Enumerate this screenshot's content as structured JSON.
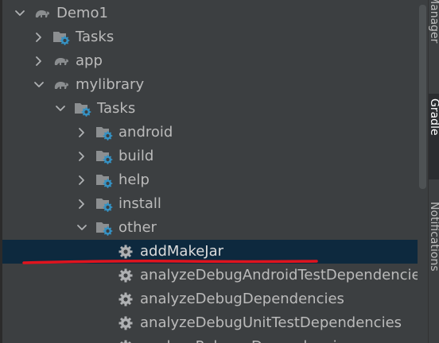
{
  "tree": {
    "rows": [
      {
        "label": "Demo1",
        "icon": "elephant-icon",
        "arrow": "down",
        "level": 0
      },
      {
        "label": "Tasks",
        "icon": "tasks-folder-icon",
        "arrow": "right",
        "level": 1
      },
      {
        "label": "app",
        "icon": "elephant-icon",
        "arrow": "right",
        "level": 1
      },
      {
        "label": "mylibrary",
        "icon": "elephant-icon",
        "arrow": "down",
        "level": 1
      },
      {
        "label": "Tasks",
        "icon": "tasks-folder-icon",
        "arrow": "down",
        "level": 2
      },
      {
        "label": "android",
        "icon": "tasks-folder-icon",
        "arrow": "right",
        "level": 3
      },
      {
        "label": "build",
        "icon": "tasks-folder-icon",
        "arrow": "right",
        "level": 3
      },
      {
        "label": "help",
        "icon": "tasks-folder-icon",
        "arrow": "right",
        "level": 3
      },
      {
        "label": "install",
        "icon": "tasks-folder-icon",
        "arrow": "right",
        "level": 3
      },
      {
        "label": "other",
        "icon": "tasks-folder-icon",
        "arrow": "down",
        "level": 3
      },
      {
        "label": "addMakeJar",
        "icon": "gear-icon",
        "arrow": "none",
        "level": 4,
        "selected": true
      },
      {
        "label": "analyzeDebugAndroidTestDependencies",
        "icon": "gear-icon",
        "arrow": "none",
        "level": 4
      },
      {
        "label": "analyzeDebugDependencies",
        "icon": "gear-icon",
        "arrow": "none",
        "level": 4
      },
      {
        "label": "analyzeDebugUnitTestDependencies",
        "icon": "gear-icon",
        "arrow": "none",
        "level": 4
      },
      {
        "label": "analyzeReleaseDependencies",
        "icon": "gear-icon",
        "arrow": "none",
        "level": 4
      }
    ]
  },
  "side_tabs": [
    {
      "label": "e Manager",
      "active": false
    },
    {
      "label": "Gradle",
      "active": true
    },
    {
      "label": "Notifications",
      "active": false
    }
  ],
  "colors": {
    "background": "#3c3f41",
    "selection": "#0d293e",
    "text": "#bbbbbb",
    "annotation": "#e0141e",
    "gear": "#afb1b3",
    "gear_accent": "#3592c4"
  }
}
